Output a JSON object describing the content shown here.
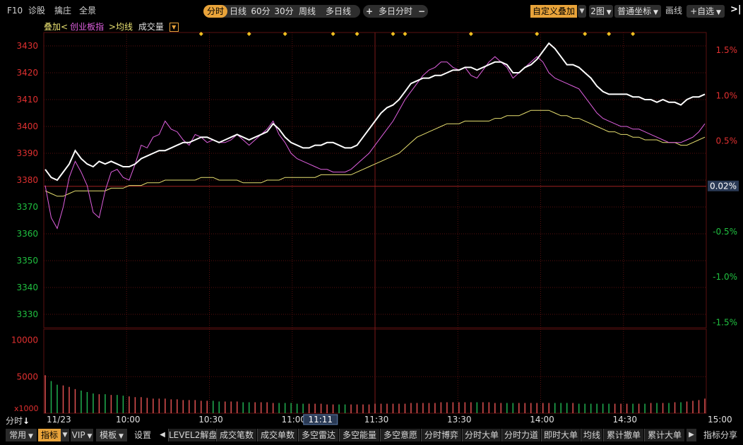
{
  "topbar": {
    "left_items": [
      "F10",
      "诊股",
      "擒庄",
      "全景"
    ],
    "period_tabs": [
      "分时",
      "日线",
      "60分",
      "30分",
      "周线",
      "多日线"
    ],
    "active_period": "分时",
    "multi_day": {
      "plus": "+",
      "label": "多日分时",
      "minus": "−"
    },
    "overlay_button": "自定义叠加",
    "layout_select": "2图",
    "coord_select": "普通坐标",
    "draw_button": "画线",
    "watchlist_button": "+自选",
    "collapse_icon": "collapse-arrow-icon"
  },
  "legend": {
    "overlay_label": "叠加",
    "lt": "<",
    "overlay_name": "创业板指",
    "gt": ">",
    "avg_label": "均线",
    "volume_label": "成交量",
    "dropdown_icon": "dropdown-icon"
  },
  "colors": {
    "price": "#ffffff",
    "overlay": "#e060e0",
    "average": "#e8e070",
    "grid": "#5a0f0f",
    "axis_left": "#e03030",
    "axis_right_up": "#e03030",
    "axis_right_down": "#20c040",
    "volume_up": "#e05050",
    "volume_down": "#20b050",
    "marker": "#f0c020",
    "crosshair_label_bg": "#2a3a55"
  },
  "price_axis": {
    "ticks": [
      "3430",
      "3420",
      "3410",
      "3400",
      "3390",
      "3380",
      "3370",
      "3360",
      "3350",
      "3340",
      "3330"
    ],
    "up_ticks": [
      "3430",
      "3420",
      "3410",
      "3400",
      "3390",
      "3380"
    ],
    "down_ticks": [
      "3370",
      "3360",
      "3350",
      "3340",
      "3330"
    ],
    "baseline": 3377.7
  },
  "pct_axis": {
    "ticks": [
      "1.5%",
      "1.0%",
      "0.5%",
      "-0.5%",
      "-1.0%",
      "-1.5%"
    ],
    "current_label": "0.02%"
  },
  "volume_axis": {
    "ticks": [
      "10000",
      "5000"
    ],
    "unit": "x1000"
  },
  "time_axis": {
    "labels": [
      "11/23",
      "10:00",
      "10:30",
      "11:00",
      "11:30",
      "13:30",
      "14:00",
      "14:30",
      "15:00"
    ],
    "crosshair_time": "11:11"
  },
  "side_labels": {
    "fenshi": "分时",
    "down_arrow_icon": "down-arrow-icon"
  },
  "chart_data": {
    "type": "line",
    "x_range": [
      "09:30",
      "15:00"
    ],
    "ylim": [
      3325,
      3435
    ],
    "series": [
      {
        "name": "",
        "color": "white",
        "values": [
          3384,
          3381,
          3380,
          3383,
          3386,
          3391,
          3388,
          3386,
          3385,
          3387,
          3386,
          3387,
          3386,
          3385,
          3385,
          3386,
          3388,
          3389,
          3390,
          3391,
          3391,
          3392,
          3393,
          3394,
          3394,
          3395,
          3396,
          3396,
          3395,
          3394,
          3395,
          3396,
          3397,
          3396,
          3395,
          3396,
          3397,
          3398,
          3401,
          3399,
          3396,
          3394,
          3393,
          3392,
          3392,
          3393,
          3393,
          3394,
          3394,
          3393,
          3392,
          3392,
          3393,
          3396,
          3399,
          3402,
          3405,
          3407,
          3408,
          3410,
          3413,
          3416,
          3417,
          3418,
          3418,
          3419,
          3419,
          3420,
          3421,
          3421,
          3422,
          3422,
          3421,
          3422,
          3423,
          3424,
          3424,
          3423,
          3420,
          3420,
          3422,
          3423,
          3425,
          3428,
          3431,
          3429,
          3426,
          3423,
          3423,
          3422,
          3420,
          3418,
          3415,
          3413,
          3412,
          3412,
          3412,
          3412,
          3411,
          3411,
          3410,
          3410,
          3409,
          3410,
          3409,
          3409,
          3408,
          3410,
          3411,
          3411,
          3412
        ]
      },
      {
        "name": "创业板指",
        "color": "magenta",
        "values": [
          3378,
          3366,
          3362,
          3370,
          3381,
          3387,
          3383,
          3378,
          3368,
          3366,
          3376,
          3383,
          3384,
          3381,
          3380,
          3386,
          3393,
          3392,
          3396,
          3397,
          3402,
          3399,
          3398,
          3395,
          3393,
          3397,
          3396,
          3394,
          3395,
          3394,
          3394,
          3395,
          3397,
          3395,
          3393,
          3395,
          3397,
          3399,
          3402,
          3397,
          3394,
          3390,
          3388,
          3387,
          3386,
          3385,
          3384,
          3384,
          3383,
          3383,
          3383,
          3384,
          3386,
          3388,
          3390,
          3393,
          3396,
          3399,
          3402,
          3406,
          3410,
          3413,
          3416,
          3419,
          3421,
          3422,
          3424,
          3424,
          3422,
          3421,
          3422,
          3419,
          3418,
          3421,
          3424,
          3426,
          3424,
          3422,
          3418,
          3420,
          3422,
          3424,
          3426,
          3424,
          3420,
          3418,
          3417,
          3416,
          3415,
          3414,
          3411,
          3408,
          3405,
          3403,
          3402,
          3401,
          3400,
          3400,
          3399,
          3399,
          3398,
          3397,
          3396,
          3395,
          3394,
          3394,
          3394,
          3395,
          3396,
          3398,
          3401
        ]
      },
      {
        "name": "",
        "color": "yellow",
        "values": [
          3376,
          3375,
          3374,
          3374,
          3375,
          3376,
          3376,
          3376,
          3376,
          3376,
          3376,
          3377,
          3377,
          3377,
          3378,
          3378,
          3378,
          3379,
          3379,
          3379,
          3380,
          3380,
          3380,
          3380,
          3380,
          3380,
          3381,
          3381,
          3381,
          3380,
          3380,
          3380,
          3380,
          3379,
          3379,
          3379,
          3379,
          3380,
          3380,
          3380,
          3381,
          3381,
          3381,
          3381,
          3381,
          3381,
          3382,
          3382,
          3382,
          3382,
          3382,
          3382,
          3383,
          3384,
          3385,
          3386,
          3387,
          3388,
          3389,
          3390,
          3392,
          3394,
          3396,
          3397,
          3398,
          3399,
          3400,
          3401,
          3401,
          3401,
          3402,
          3402,
          3402,
          3402,
          3402,
          3403,
          3403,
          3404,
          3404,
          3404,
          3405,
          3406,
          3406,
          3406,
          3406,
          3405,
          3404,
          3404,
          3403,
          3403,
          3402,
          3401,
          3400,
          3399,
          3398,
          3398,
          3397,
          3397,
          3396,
          3396,
          3395,
          3395,
          3395,
          3394,
          3394,
          3394,
          3393,
          3393,
          3394,
          3395,
          3396
        ]
      }
    ],
    "volume": {
      "ylim": [
        0,
        11500
      ],
      "values": [
        5200,
        4400,
        3900,
        3800,
        3600,
        3300,
        3100,
        2900,
        2700,
        2600,
        2600,
        2500,
        2500,
        2400,
        2300,
        2200,
        2200,
        2100,
        2000,
        2000,
        2000,
        1900,
        1900,
        1800,
        1800,
        1800,
        1700,
        1700,
        1700,
        1600,
        1600,
        1600,
        1600,
        1500,
        1500,
        1500,
        1500,
        1500,
        1400,
        1400,
        1400,
        1400,
        1300,
        1300,
        1300,
        1300,
        1300,
        1200,
        1200,
        1200,
        1200,
        1200,
        1200,
        1200,
        1200,
        1300,
        1300,
        1300,
        1300,
        1300,
        1300,
        1400,
        1400,
        1400,
        1400,
        1400,
        1500,
        1500,
        1500,
        1500,
        1500,
        1500,
        1500,
        1500,
        1500,
        1400,
        1400,
        1400,
        1400,
        1400,
        1400,
        1400,
        1400,
        1400,
        1400,
        1400,
        1400,
        1400,
        1400,
        1300,
        1300,
        1300,
        1300,
        1300,
        1300,
        1300,
        1300,
        1300,
        1300,
        1300,
        1300,
        1400,
        1400,
        1400,
        1400,
        1500,
        1500,
        1600,
        1700,
        1800,
        2000
      ]
    }
  },
  "bottombar": {
    "left_buttons": [
      "常用",
      "指标",
      "VIP",
      "模板"
    ],
    "active_left": "指标",
    "settings": "设置",
    "tabs": [
      "LEVEL2解盘",
      "成交笔数",
      "成交单数",
      "多空雷达",
      "多空能量",
      "多空意愿",
      "分时博弈",
      "分时大单",
      "分时力道",
      "即时大单",
      "均线",
      "累计撤单",
      "累计大单"
    ],
    "right_button": "指标分享"
  }
}
